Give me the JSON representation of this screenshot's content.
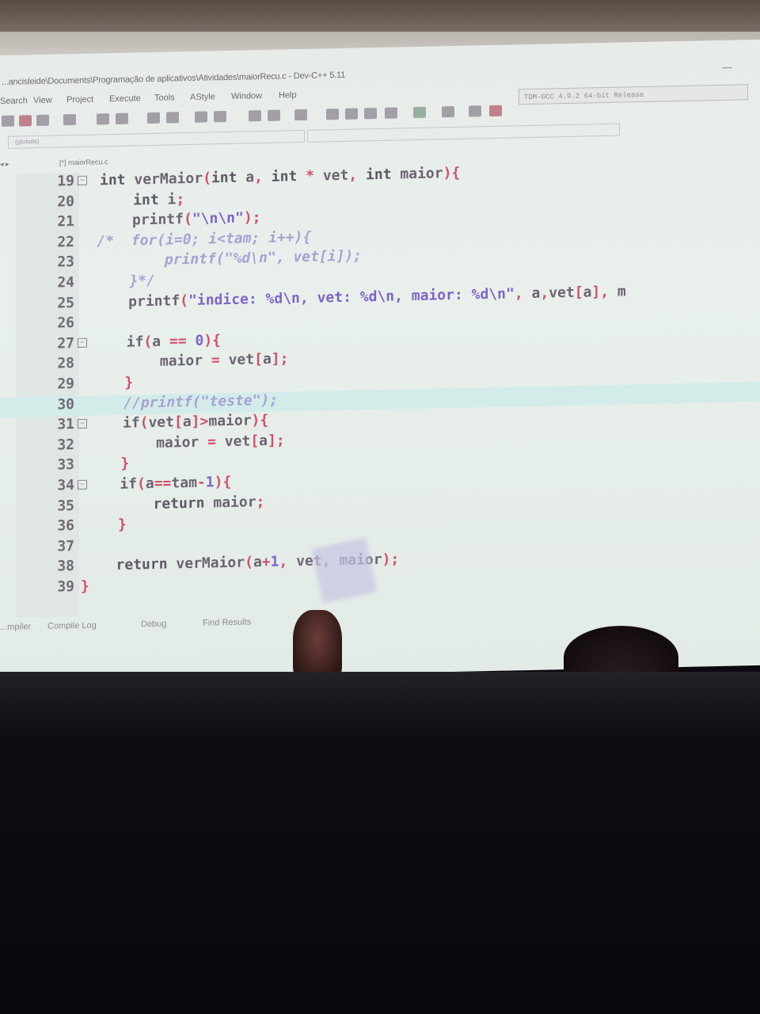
{
  "window": {
    "title": "...ancisleide\\Documents\\Programação de aplicativos\\Atividades\\maiorRecu.c - Dev-C++ 5.11",
    "winbtn": "—"
  },
  "menu": [
    "Search",
    "View",
    "Project",
    "Execute",
    "Tools",
    "AStyle",
    "Window",
    "Help"
  ],
  "compiler": "TDM-GCC 4.9.2 64-bit Release",
  "scope": "(globals)",
  "tab": {
    "arrows": "◂  ▸",
    "file": "[*] maiorRecu.c"
  },
  "code": [
    {
      "ln": "19",
      "fold": "⊟",
      "segs": [
        {
          "c": "kw",
          "t": "int "
        },
        {
          "c": "plain",
          "t": "verMaior"
        },
        {
          "c": "punc",
          "t": "("
        },
        {
          "c": "kw",
          "t": "int "
        },
        {
          "c": "plain",
          "t": "a"
        },
        {
          "c": "punc",
          "t": ", "
        },
        {
          "c": "kw",
          "t": "int "
        },
        {
          "c": "punc",
          "t": "* "
        },
        {
          "c": "plain",
          "t": "vet"
        },
        {
          "c": "punc",
          "t": ", "
        },
        {
          "c": "kw",
          "t": "int "
        },
        {
          "c": "plain",
          "t": "maior"
        },
        {
          "c": "punc",
          "t": "){"
        }
      ]
    },
    {
      "ln": "20",
      "segs": [
        {
          "c": "kw",
          "t": "    int "
        },
        {
          "c": "plain",
          "t": "i"
        },
        {
          "c": "punc",
          "t": ";"
        }
      ]
    },
    {
      "ln": "21",
      "segs": [
        {
          "c": "plain",
          "t": "    printf"
        },
        {
          "c": "punc",
          "t": "("
        },
        {
          "c": "str",
          "t": "\"\\n\\n\""
        },
        {
          "c": "punc",
          "t": ");"
        }
      ]
    },
    {
      "ln": "22",
      "segs": [
        {
          "c": "comment",
          "t": "/*  for(i=0; i<tam; i++){"
        }
      ]
    },
    {
      "ln": "23",
      "segs": [
        {
          "c": "comment",
          "t": "        printf(\"%d\\n\", vet[i]);"
        }
      ]
    },
    {
      "ln": "24",
      "segs": [
        {
          "c": "comment",
          "t": "    }*/"
        }
      ]
    },
    {
      "ln": "25",
      "segs": [
        {
          "c": "plain",
          "t": "    printf"
        },
        {
          "c": "punc",
          "t": "("
        },
        {
          "c": "str",
          "t": "\"indice: %d\\n, vet: %d\\n, maior: %d\\n\""
        },
        {
          "c": "punc",
          "t": ", "
        },
        {
          "c": "plain",
          "t": "a"
        },
        {
          "c": "punc",
          "t": ","
        },
        {
          "c": "plain",
          "t": "vet"
        },
        {
          "c": "punc",
          "t": "["
        },
        {
          "c": "plain",
          "t": "a"
        },
        {
          "c": "punc",
          "t": "], "
        },
        {
          "c": "plain",
          "t": "m"
        }
      ]
    },
    {
      "ln": "26",
      "segs": []
    },
    {
      "ln": "27",
      "fold": "⊟",
      "segs": [
        {
          "c": "plain",
          "t": "    if"
        },
        {
          "c": "punc",
          "t": "("
        },
        {
          "c": "plain",
          "t": "a "
        },
        {
          "c": "punc",
          "t": "== "
        },
        {
          "c": "str",
          "t": "0"
        },
        {
          "c": "punc",
          "t": "){"
        }
      ]
    },
    {
      "ln": "28",
      "segs": [
        {
          "c": "plain",
          "t": "        maior "
        },
        {
          "c": "punc",
          "t": "= "
        },
        {
          "c": "plain",
          "t": "vet"
        },
        {
          "c": "punc",
          "t": "["
        },
        {
          "c": "plain",
          "t": "a"
        },
        {
          "c": "punc",
          "t": "];"
        }
      ]
    },
    {
      "ln": "29",
      "segs": [
        {
          "c": "punc",
          "t": "    }"
        }
      ]
    },
    {
      "ln": "30",
      "hl": true,
      "segs": [
        {
          "c": "comment",
          "t": "    //printf(\"teste\");"
        }
      ]
    },
    {
      "ln": "31",
      "fold": "⊟",
      "segs": [
        {
          "c": "plain",
          "t": "    if"
        },
        {
          "c": "punc",
          "t": "("
        },
        {
          "c": "plain",
          "t": "vet"
        },
        {
          "c": "punc",
          "t": "["
        },
        {
          "c": "plain",
          "t": "a"
        },
        {
          "c": "punc",
          "t": "]>"
        },
        {
          "c": "plain",
          "t": "maior"
        },
        {
          "c": "punc",
          "t": "){"
        }
      ]
    },
    {
      "ln": "32",
      "segs": [
        {
          "c": "plain",
          "t": "        maior "
        },
        {
          "c": "punc",
          "t": "= "
        },
        {
          "c": "plain",
          "t": "vet"
        },
        {
          "c": "punc",
          "t": "["
        },
        {
          "c": "plain",
          "t": "a"
        },
        {
          "c": "punc",
          "t": "];"
        }
      ]
    },
    {
      "ln": "33",
      "segs": [
        {
          "c": "punc",
          "t": "    }"
        }
      ]
    },
    {
      "ln": "34",
      "fold": "⊟",
      "segs": [
        {
          "c": "plain",
          "t": "    if"
        },
        {
          "c": "punc",
          "t": "("
        },
        {
          "c": "plain",
          "t": "a"
        },
        {
          "c": "punc",
          "t": "=="
        },
        {
          "c": "plain",
          "t": "tam"
        },
        {
          "c": "punc",
          "t": "-"
        },
        {
          "c": "str",
          "t": "1"
        },
        {
          "c": "punc",
          "t": "){"
        }
      ]
    },
    {
      "ln": "35",
      "segs": [
        {
          "c": "kw",
          "t": "        return "
        },
        {
          "c": "plain",
          "t": "maior"
        },
        {
          "c": "punc",
          "t": ";"
        }
      ]
    },
    {
      "ln": "36",
      "segs": [
        {
          "c": "punc",
          "t": "    }"
        }
      ]
    },
    {
      "ln": "37",
      "segs": []
    },
    {
      "ln": "38",
      "segs": [
        {
          "c": "kw",
          "t": "    return "
        },
        {
          "c": "plain",
          "t": "verMaior"
        },
        {
          "c": "punc",
          "t": "("
        },
        {
          "c": "plain",
          "t": "a"
        },
        {
          "c": "punc",
          "t": "+"
        },
        {
          "c": "str",
          "t": "1"
        },
        {
          "c": "punc",
          "t": ", "
        },
        {
          "c": "plain",
          "t": "vet"
        },
        {
          "c": "punc",
          "t": ", "
        },
        {
          "c": "plain",
          "t": "maior"
        },
        {
          "c": "punc",
          "t": ");"
        }
      ]
    },
    {
      "ln": "39",
      "segs": [
        {
          "c": "punc",
          "t": "}"
        }
      ]
    }
  ],
  "bottom_tabs": [
    "...mpiler",
    "Compile Log",
    "Debug",
    "Find Results"
  ]
}
